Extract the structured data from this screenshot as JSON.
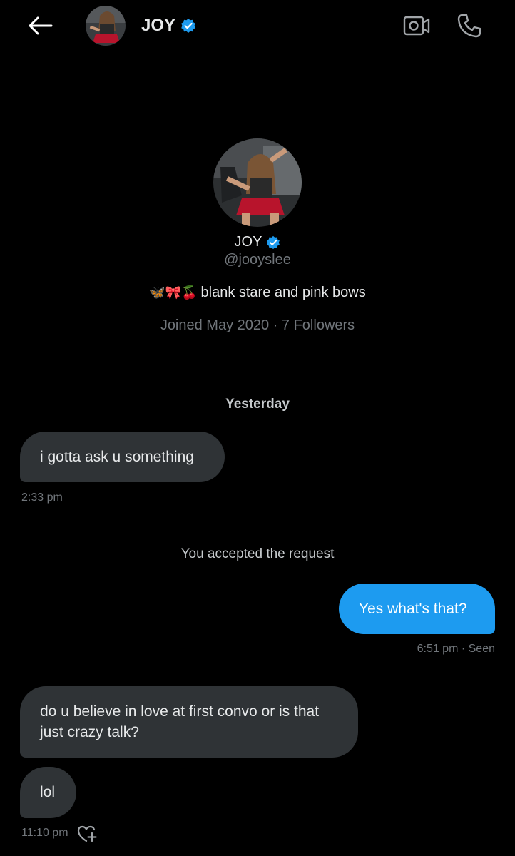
{
  "header": {
    "contact_name": "JOY",
    "back_icon": "arrow-left-icon",
    "video_icon": "video-call-icon",
    "call_icon": "phone-icon"
  },
  "profile": {
    "name": "JOY",
    "handle": "@jooyslee",
    "bio_emojis": "🦋🎀🍒",
    "bio_text": "blank stare and pink bows",
    "joined": "Joined May 2020 · 7 Followers"
  },
  "conversation": {
    "date_separator": "Yesterday",
    "system_message": "You accepted the request",
    "messages": [
      {
        "from": "them",
        "text": "i gotta ask u something"
      },
      {
        "from": "me",
        "text": "Yes what's that?"
      },
      {
        "from": "them",
        "text": "do u believe in love at first convo or is that just crazy talk?"
      },
      {
        "from": "them",
        "text": "lol"
      }
    ],
    "timestamps": [
      "2:33 pm",
      "6:51 pm · Seen",
      "11:10 pm"
    ]
  },
  "colors": {
    "background": "#000000",
    "accent_blue": "#1d9bf0",
    "incoming_bubble": "#2f3336",
    "muted_text": "#71767b",
    "verified": "#1d9bf0"
  }
}
